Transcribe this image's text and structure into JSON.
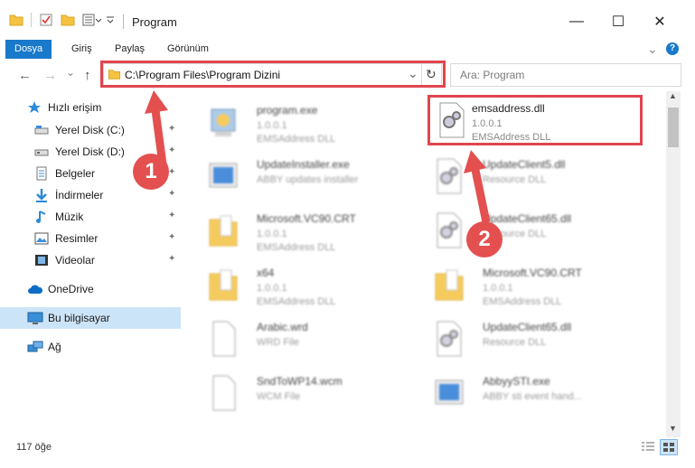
{
  "window": {
    "title": "Program",
    "minimize_glyph": "—",
    "maximize_glyph": "☐",
    "close_glyph": "✕"
  },
  "ribbon": {
    "tabs": [
      {
        "label": "Dosya",
        "active": true
      },
      {
        "label": "Giriş",
        "active": false
      },
      {
        "label": "Paylaş",
        "active": false
      },
      {
        "label": "Görünüm",
        "active": false
      }
    ],
    "help_glyph": "?",
    "expand_glyph": "⌄"
  },
  "address": {
    "path": "C:\\Program Files\\Program Dizini",
    "refresh_glyph": "↻",
    "dropdown_glyph": "⌄"
  },
  "search": {
    "placeholder": "Ara: Program"
  },
  "sidebar": {
    "items": [
      {
        "label": "Hızlı erişim",
        "icon": "star-icon",
        "pinned": false
      },
      {
        "label": "Yerel Disk (C:)",
        "icon": "drive-icon",
        "pinned": true
      },
      {
        "label": "Yerel Disk (D:)",
        "icon": "drive-icon",
        "pinned": true
      },
      {
        "label": "Belgeler",
        "icon": "documents-icon",
        "pinned": true
      },
      {
        "label": "İndirmeler",
        "icon": "download-icon",
        "pinned": true
      },
      {
        "label": "Müzik",
        "icon": "music-icon",
        "pinned": true
      },
      {
        "label": "Resimler",
        "icon": "pictures-icon",
        "pinned": true
      },
      {
        "label": "Videolar",
        "icon": "video-icon",
        "pinned": true
      },
      {
        "label": "OneDrive",
        "icon": "cloud-icon",
        "pinned": false
      },
      {
        "label": "Bu bilgisayar",
        "icon": "computer-icon",
        "pinned": false
      },
      {
        "label": "Ağ",
        "icon": "network-icon",
        "pinned": false
      }
    ],
    "pin_glyph": "📌"
  },
  "files": [
    {
      "name": "program.exe",
      "line1": "1.0.0.1",
      "line2": "EMSAddress DLL",
      "icon": "exe-icon"
    },
    {
      "name": "emsaddress.dll",
      "line1": "1.0.0.1",
      "line2": "EMSAddress DLL",
      "icon": "dll-gear-icon"
    },
    {
      "name": "UpdateInstaller.exe",
      "line1": "ABBY updates installer",
      "line2": "",
      "icon": "installer-icon"
    },
    {
      "name": "UpdateClient5.dll",
      "line1": "Resource DLL",
      "line2": "",
      "icon": "dll-gear-icon"
    },
    {
      "name": "Microsoft.VC90.CRT",
      "line1": "1.0.0.1",
      "line2": "EMSAddress DLL",
      "icon": "folder-icon"
    },
    {
      "name": "UpdateClient65.dll",
      "line1": "Resource DLL",
      "line2": "",
      "icon": "dll-gear-icon"
    },
    {
      "name": "x64",
      "line1": "1.0.0.1",
      "line2": "EMSAddress DLL",
      "icon": "folder-icon"
    },
    {
      "name": "Microsoft.VC90.CRT",
      "line1": "1.0.0.1",
      "line2": "EMSAddress DLL",
      "icon": "folder-icon"
    },
    {
      "name": "Arabic.wrd",
      "line1": "WRD File",
      "line2": "",
      "icon": "blank-file-icon"
    },
    {
      "name": "UpdateClient65.dll",
      "line1": "Resource DLL",
      "line2": "",
      "icon": "dll-gear-icon"
    },
    {
      "name": "SndToWP14.wcm",
      "line1": "WCM File",
      "line2": "",
      "icon": "blank-file-icon"
    },
    {
      "name": "AbbyySTI.exe",
      "line1": "ABBY sti event hand...",
      "line2": "",
      "icon": "installer-icon"
    }
  ],
  "annotations": {
    "badge_1": "1",
    "badge_2": "2"
  },
  "status": {
    "item_count": "117 öğe"
  },
  "colors": {
    "accent": "#1979ca",
    "highlight": "#e0454f",
    "selected": "#cce4f7"
  }
}
